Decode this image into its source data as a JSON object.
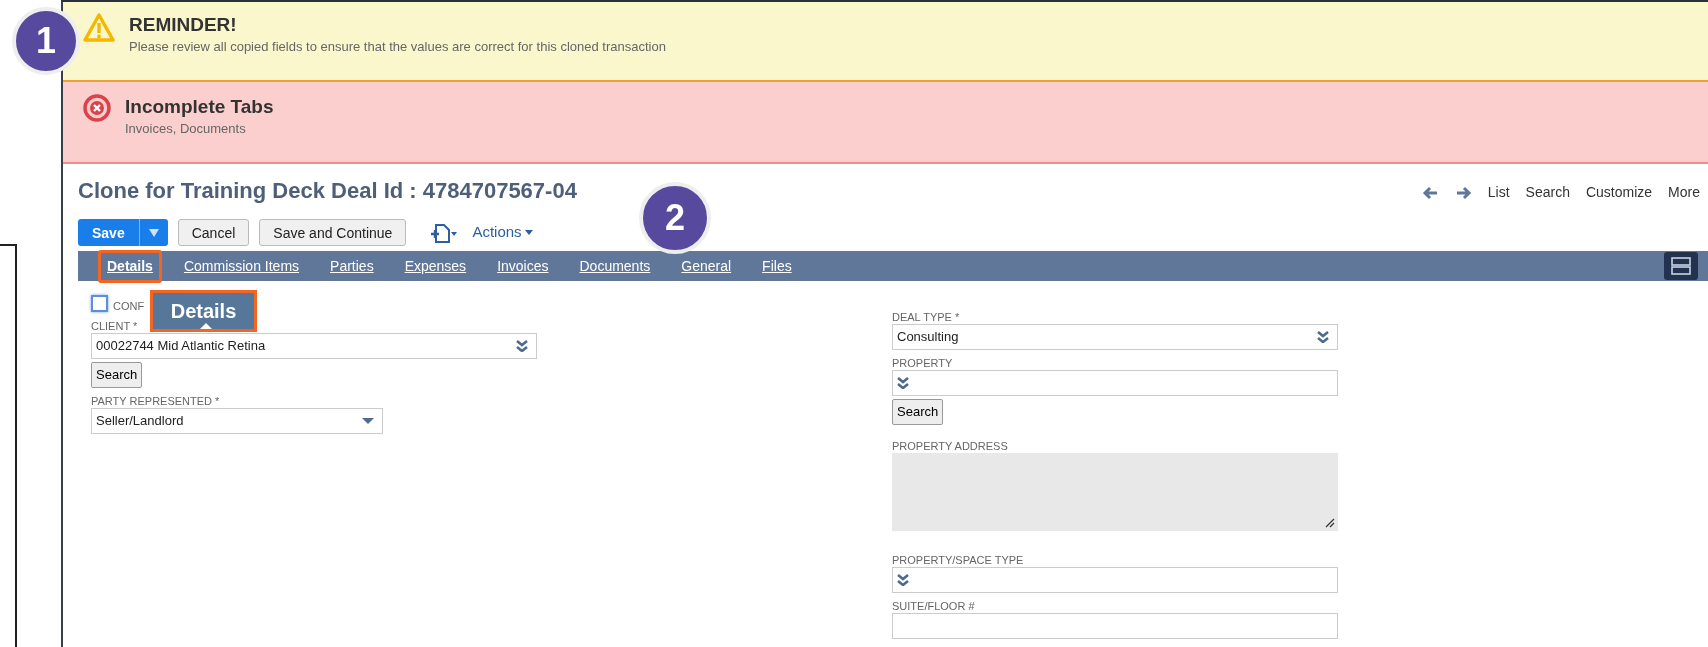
{
  "callouts": [
    {
      "label": "1"
    },
    {
      "label": "2"
    }
  ],
  "alerts": [
    {
      "kind": "warning",
      "title": "REMINDER!",
      "message": "Please review all copied fields to ensure that the values are correct for this cloned transaction"
    },
    {
      "kind": "error",
      "title": "Incomplete Tabs",
      "message": "Invoices, Documents"
    }
  ],
  "page_title": "Clone for Training Deck Deal Id : 4784707567-04",
  "nav_links": [
    "List",
    "Search",
    "Customize",
    "More"
  ],
  "buttons": [
    {
      "kind": "split",
      "label": "Save"
    },
    {
      "kind": "plain",
      "label": "Cancel"
    },
    {
      "kind": "plain",
      "label": "Save and Continue"
    },
    {
      "kind": "new-menu"
    },
    {
      "kind": "menu",
      "label": "Actions"
    }
  ],
  "tabs": [
    {
      "label": "Details",
      "selected": true
    },
    {
      "label": "Commission Items",
      "selected": false
    },
    {
      "label": "Parties",
      "selected": false
    },
    {
      "label": "Expenses",
      "selected": false
    },
    {
      "label": "Invoices",
      "selected": false
    },
    {
      "label": "Documents",
      "selected": false
    },
    {
      "label": "General",
      "selected": false
    },
    {
      "label": "Files",
      "selected": false
    }
  ],
  "tab_tooltip": {
    "label": "Details"
  },
  "left_fields": [
    {
      "kind": "checkbox",
      "label": "CONF",
      "checked": false
    },
    {
      "kind": "combo",
      "label": "CLIENT *",
      "value": "00022744 Mid Atlantic Retina"
    },
    {
      "kind": "button",
      "label": "Search"
    },
    {
      "kind": "dropdown",
      "label": "PARTY REPRESENTED *",
      "value": "Seller/Landlord"
    }
  ],
  "right_fields": [
    {
      "kind": "combo",
      "label": "DEAL TYPE *",
      "value": "Consulting"
    },
    {
      "kind": "combo",
      "label": "PROPERTY"
    },
    {
      "kind": "button",
      "label": "Search"
    },
    {
      "kind": "textarea",
      "label": "PROPERTY ADDRESS"
    },
    {
      "kind": "combo",
      "label": "PROPERTY/SPACE TYPE"
    },
    {
      "kind": "text",
      "label": "SUITE/FLOOR #"
    }
  ]
}
